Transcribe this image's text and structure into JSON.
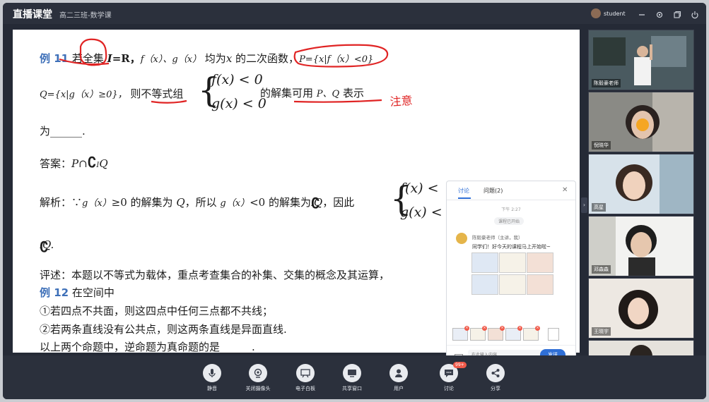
{
  "app": {
    "title": "直播课堂",
    "class_name": "高二三班-数学课",
    "user": "student"
  },
  "slide": {
    "l1_label": "例 11",
    "l1_a": " 若全集 ",
    "l1_b": "I",
    "l1_c": "=R，",
    "l1_d": "f（x）、g（x）",
    "l1_e": " 均为",
    "l1_f": "x",
    "l1_g": " 的二次函数，",
    "l1_h": "P={x|f（x）<0}",
    "l2_a": "Q={x|g（x）≥0}，",
    "l2_b": " 则不等式组",
    "l2_c": " 的解集可用 ",
    "l2_d": "P、Q",
    "l2_e": " 表示",
    "sys_top": "f(x) < 0",
    "sys_bottom": "g(x) < 0",
    "l3": "为______.",
    "l4_a": "答案：",
    "l4_b": "P∩",
    "l4_c": "Q",
    "l5_a": "解析：∵",
    "l5_b": "g（x）",
    "l5_c": "≥0 的解集为 ",
    "l5_d": "Q",
    "l5_e": "，所以 ",
    "l5_f": "g（x）",
    "l5_g": "<0 的解集为",
    "l5_h": "Q",
    "l5_i": "，因此",
    "sys2_top": "f(x) <",
    "sys2_bottom": "g(x) <",
    "l6": "Q.",
    "l7": "评述：本题以不等式为载体，重点考查集合的补集、交集的概念及其运算，",
    "l8_label": "例 12",
    "l8_text": " 在空间中",
    "l9": "①若四点不共面，则这四点中任何三点都不共线；",
    "l10": "②若两条直线没有公共点，则这两条直线是异面直线.",
    "l11": "以上两个命题中，逆命题为真命题的是______.",
    "ink_note": "注意"
  },
  "videos": [
    {
      "name": "陈毅豪老师"
    },
    {
      "name": "倪晓华"
    },
    {
      "name": "高星"
    },
    {
      "name": "邓森森"
    },
    {
      "name": "王晓宇"
    },
    {
      "name": ""
    }
  ],
  "chat": {
    "tab_discuss": "讨论",
    "tab_questions": "问题(2)",
    "time": "下午 2:27",
    "system": "课程已开始",
    "sender": "陈毅豪老师（主讲，我）",
    "message": "同学们！好今天的课程马上开始啦~",
    "placeholder": "在此输入内容",
    "send": "发送"
  },
  "toolbar": {
    "mute": "静音",
    "camera": "关闭摄像头",
    "whiteboard": "电子白板",
    "share": "共享窗口",
    "users": "用户",
    "discuss": "讨论",
    "discuss_badge": "99+",
    "share2": "分享"
  },
  "colors": {
    "accent": "#2f6fd6",
    "ink": "#e02424",
    "example_blue": "#3d6fb8"
  }
}
